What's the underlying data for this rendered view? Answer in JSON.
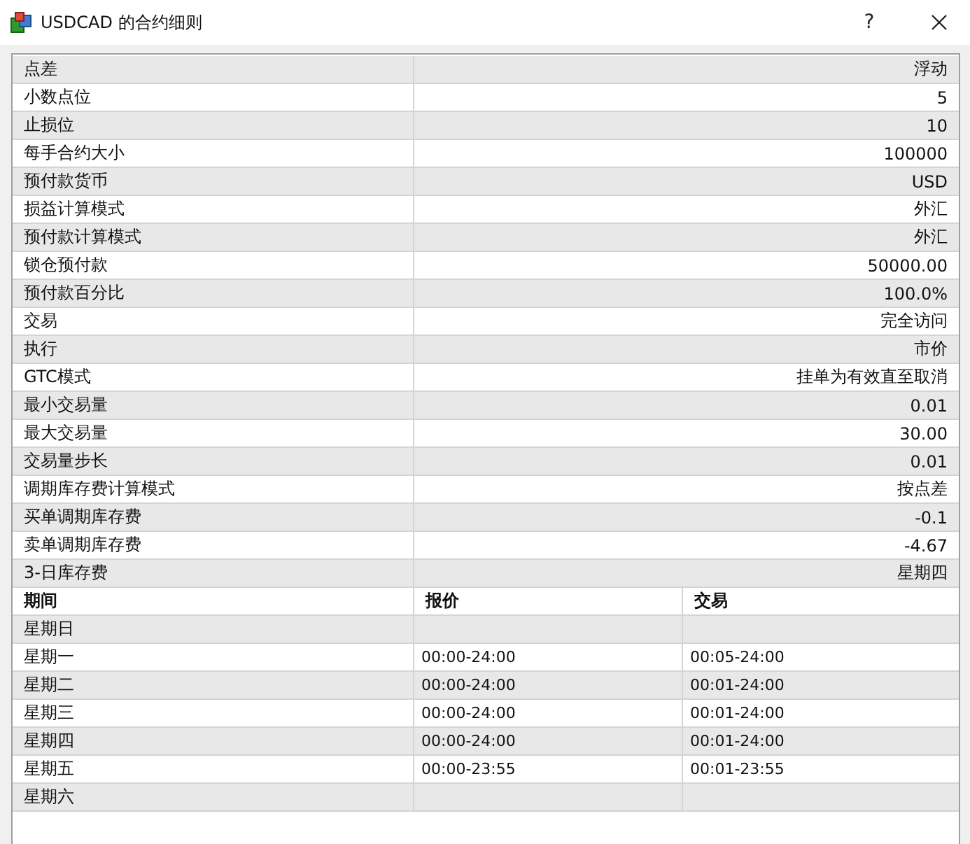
{
  "window": {
    "title": "USDCAD 的合约细则",
    "help": "?"
  },
  "properties": [
    {
      "label": "点差",
      "value": "浮动"
    },
    {
      "label": "小数点位",
      "value": "5"
    },
    {
      "label": "止损位",
      "value": "10"
    },
    {
      "label": "每手合约大小",
      "value": "100000"
    },
    {
      "label": "预付款货币",
      "value": "USD"
    },
    {
      "label": "损益计算模式",
      "value": "外汇"
    },
    {
      "label": "预付款计算模式",
      "value": "外汇"
    },
    {
      "label": "锁仓预付款",
      "value": "50000.00"
    },
    {
      "label": "预付款百分比",
      "value": "100.0%"
    },
    {
      "label": "交易",
      "value": "完全访问"
    },
    {
      "label": "执行",
      "value": "市价"
    },
    {
      "label": "GTC模式",
      "value": "挂单为有效直至取消"
    },
    {
      "label": "最小交易量",
      "value": "0.01"
    },
    {
      "label": "最大交易量",
      "value": "30.00"
    },
    {
      "label": "交易量步长",
      "value": "0.01"
    },
    {
      "label": "调期库存费计算模式",
      "value": "按点差"
    },
    {
      "label": "买单调期库存费",
      "value": "-0.1"
    },
    {
      "label": "卖单调期库存费",
      "value": "-4.67"
    },
    {
      "label": "3-日库存费",
      "value": "星期四"
    }
  ],
  "schedule": {
    "columns": [
      "期间",
      "报价",
      "交易"
    ],
    "rows": [
      {
        "day": "星期日"
      },
      {
        "day": "星期一",
        "quote": "00:00-24:00",
        "trade": "00:05-24:00"
      },
      {
        "day": "星期二",
        "quote": "00:00-24:00",
        "trade": "00:01-24:00"
      },
      {
        "day": "星期三",
        "quote": "00:00-24:00",
        "trade": "00:01-24:00"
      },
      {
        "day": "星期四",
        "quote": "00:00-24:00",
        "trade": "00:01-24:00"
      },
      {
        "day": "星期五",
        "quote": "00:00-23:55",
        "trade": "00:01-23:55"
      },
      {
        "day": "星期六"
      }
    ]
  }
}
